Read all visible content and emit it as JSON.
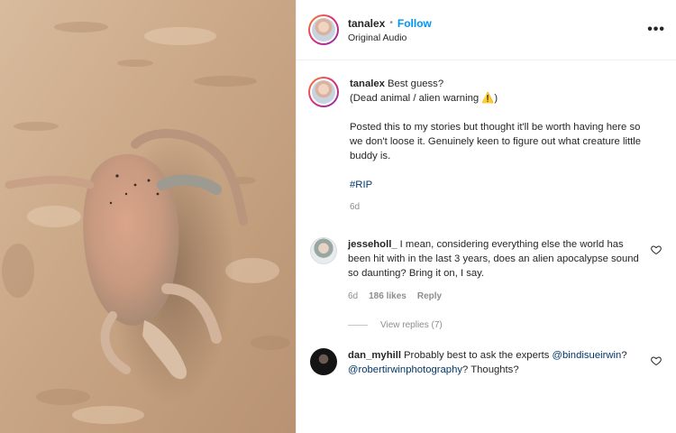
{
  "post": {
    "username": "tanalex",
    "separator": "•",
    "follow_label": "Follow",
    "audio": "Original Audio",
    "more_label": "•••"
  },
  "caption": {
    "username": "tanalex",
    "line1": "Best guess?",
    "line2": "(Dead animal / alien warning ⚠️)",
    "paragraph": "Posted this to my stories but thought it'll be worth having here so we don't loose it. Genuinely keen to figure out what creature little buddy is.",
    "hashtag": "#RIP",
    "time": "6d"
  },
  "comments": [
    {
      "username": "jesseholl_",
      "text": "I mean, considering everything else the world has been hit with in the last 3 years, does an alien apocalypse sound so daunting? Bring it on, I say.",
      "time": "6d",
      "likes": "186 likes",
      "reply_label": "Reply",
      "view_replies": "View replies (7)"
    },
    {
      "username": "dan_myhill",
      "text_before": "Probably best to ask the experts",
      "mention1": "@bindisueirwin",
      "mention2": "@robertirwinphotography",
      "text_after": "? Thoughts?",
      "q_mark": "?"
    }
  ],
  "icons": {
    "heart": "heart-icon",
    "more": "more-icon"
  },
  "colors": {
    "follow": "#0095f6",
    "link": "#00376b",
    "muted": "#8e8e8e",
    "sand": "#c9a989"
  }
}
